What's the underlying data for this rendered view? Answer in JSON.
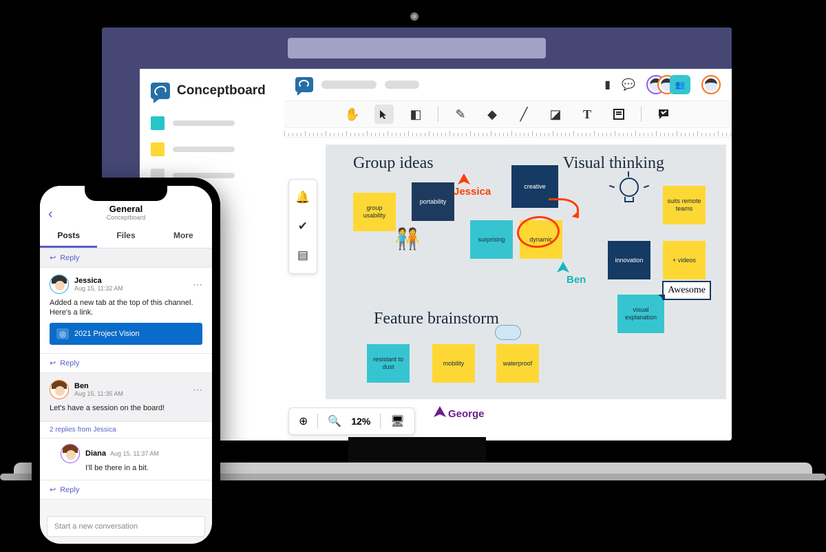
{
  "sidebar": {
    "app_name": "Conceptboard"
  },
  "app": {
    "footer_zoom": "12%",
    "board": {
      "headings": {
        "group_ideas": "Group ideas",
        "visual_thinking": "Visual thinking",
        "feature_brainstorm": "Feature brainstorm"
      },
      "notes": {
        "group_usability": "group usability",
        "portability": "portability",
        "creative": "creative",
        "surprising": "surprising",
        "dynamic": "dynamic",
        "suits_remote_teams": "suits remote teams",
        "innovation": "innovation",
        "plus_videos": "+ videos",
        "visual_explanation": "visual explanation",
        "resistant_to_dust": "resistant to dust",
        "mobility": "mobility",
        "waterproof": "waterproof"
      },
      "awesome": "Awesome",
      "cursors": {
        "jessica": "Jessica",
        "ben": "Ben",
        "george": "George"
      }
    }
  },
  "phone": {
    "header_title": "General",
    "header_sub": "Conceptboard",
    "tabs": {
      "posts": "Posts",
      "files": "Files",
      "more": "More"
    },
    "reply_label": "Reply",
    "posts": {
      "jessica": {
        "name": "Jessica",
        "time": "Aug 15, 11:32 AM",
        "body": "Added a new tab at the top of this channel. Here's a link.",
        "link_title": "2021 Project Vision"
      },
      "ben": {
        "name": "Ben",
        "time": "Aug 15, 11:35 AM",
        "body": "Let's have a session on the board!",
        "replies_from": "2 replies from Jessica"
      },
      "diana": {
        "name": "Diana",
        "time": "Aug 15, 11:37 AM",
        "body": "I'll be there in a bit."
      }
    },
    "new_conversation_placeholder": "Start a new conversation"
  }
}
